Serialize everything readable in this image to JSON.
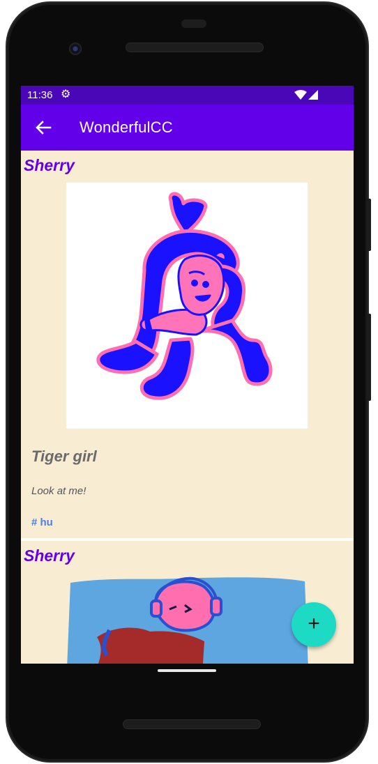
{
  "status_bar": {
    "time": "11:36",
    "settings_icon": "gear-icon",
    "wifi_icon": "wifi-icon",
    "signal_icon": "signal-icon"
  },
  "app_bar": {
    "title": "WonderfulCC",
    "back_icon": "arrow-back-icon"
  },
  "posts": [
    {
      "author": "Sherry",
      "image": "tiger-girl-illustration",
      "title": "Tiger girl",
      "description": "Look at me!",
      "tag": "# hu"
    },
    {
      "author": "Sherry",
      "image": "girl-with-headphones-illustration"
    }
  ],
  "fab": {
    "icon": "plus-icon",
    "label": "+"
  },
  "colors": {
    "status_bar": "#4a07b7",
    "app_bar": "#6200ea",
    "card_background": "#f8edd2",
    "author_text": "#6200ea",
    "tag_text": "#4f7de8",
    "fab": "#1ddac5"
  }
}
